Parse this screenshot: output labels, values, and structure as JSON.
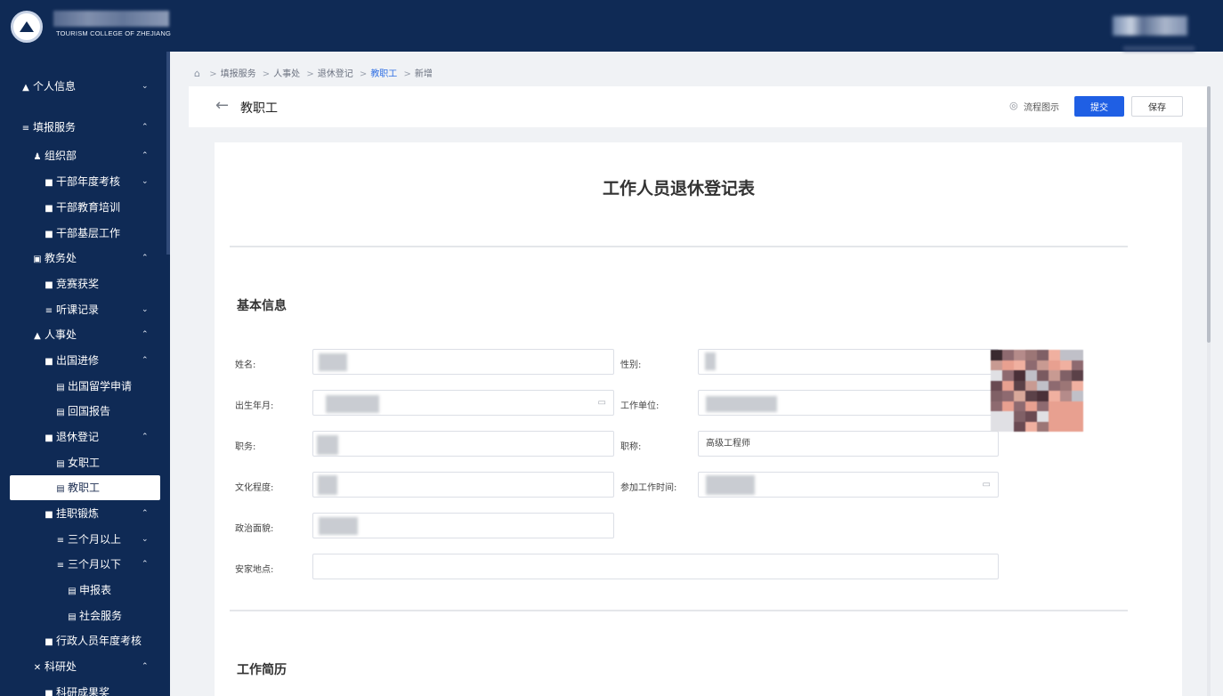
{
  "header": {
    "logo_en": "TOURISM COLLEGE OF ZHEJIANG"
  },
  "sidebar": {
    "items": [
      {
        "label": "个人信息",
        "icon": "user-icon",
        "chevron": "down"
      },
      {
        "label": "填报服务",
        "icon": "list-icon",
        "chevron": "up"
      },
      {
        "label": "组织部",
        "icon": "users-icon",
        "chevron": "up"
      },
      {
        "label": "干部年度考核",
        "icon": "doc-icon",
        "chevron": "down"
      },
      {
        "label": "干部教育培训",
        "icon": "doc-icon",
        "chevron": ""
      },
      {
        "label": "干部基层工作",
        "icon": "doc-icon",
        "chevron": ""
      },
      {
        "label": "教务处",
        "icon": "book-icon",
        "chevron": "up"
      },
      {
        "label": "竞赛获奖",
        "icon": "doc-icon",
        "chevron": ""
      },
      {
        "label": "听课记录",
        "icon": "list-icon",
        "chevron": "down"
      },
      {
        "label": "人事处",
        "icon": "user-icon",
        "chevron": "up"
      },
      {
        "label": "出国进修",
        "icon": "doc-icon",
        "chevron": "up"
      },
      {
        "label": "出国留学申请",
        "icon": "file-icon",
        "chevron": ""
      },
      {
        "label": "回国报告",
        "icon": "file-icon",
        "chevron": ""
      },
      {
        "label": "退休登记",
        "icon": "doc-icon",
        "chevron": "up"
      },
      {
        "label": "女职工",
        "icon": "file-icon",
        "chevron": ""
      },
      {
        "label": "教职工",
        "icon": "file-icon",
        "chevron": "",
        "active": true
      },
      {
        "label": "挂职锻炼",
        "icon": "doc-icon",
        "chevron": "up"
      },
      {
        "label": "三个月以上",
        "icon": "list-icon",
        "chevron": "down"
      },
      {
        "label": "三个月以下",
        "icon": "list-icon",
        "chevron": "up"
      },
      {
        "label": "申报表",
        "icon": "file-icon",
        "chevron": ""
      },
      {
        "label": "社会服务",
        "icon": "file-icon",
        "chevron": ""
      },
      {
        "label": "行政人员年度考核",
        "icon": "doc-icon",
        "chevron": ""
      },
      {
        "label": "科研处",
        "icon": "tools-icon",
        "chevron": "up"
      },
      {
        "label": "科研成果奖",
        "icon": "doc-icon",
        "chevron": ""
      }
    ]
  },
  "breadcrumb": {
    "items": [
      "填报服务",
      "人事处",
      "退休登记",
      "教职工",
      "新增"
    ]
  },
  "page_header": {
    "title": "教职工",
    "flow_label": "流程图示",
    "submit_label": "提交",
    "save_label": "保存"
  },
  "form": {
    "title": "工作人员退休登记表",
    "section_basic": "基本信息",
    "section_resume": "工作简历",
    "labels": {
      "name": "姓名:",
      "gender": "性别:",
      "birth": "出生年月:",
      "work_unit": "工作单位:",
      "position": "职务:",
      "job_title": "职称:",
      "education": "文化程度:",
      "work_start": "参加工作时间:",
      "political": "政治面貌:",
      "settle_place": "安家地点:"
    },
    "values": {
      "job_title": "高级工程师",
      "settle_place": ""
    }
  },
  "colors": {
    "sidebar_bg": "#0f2a55",
    "primary": "#1f5fe4",
    "active_crumb": "#2f6fe4"
  }
}
